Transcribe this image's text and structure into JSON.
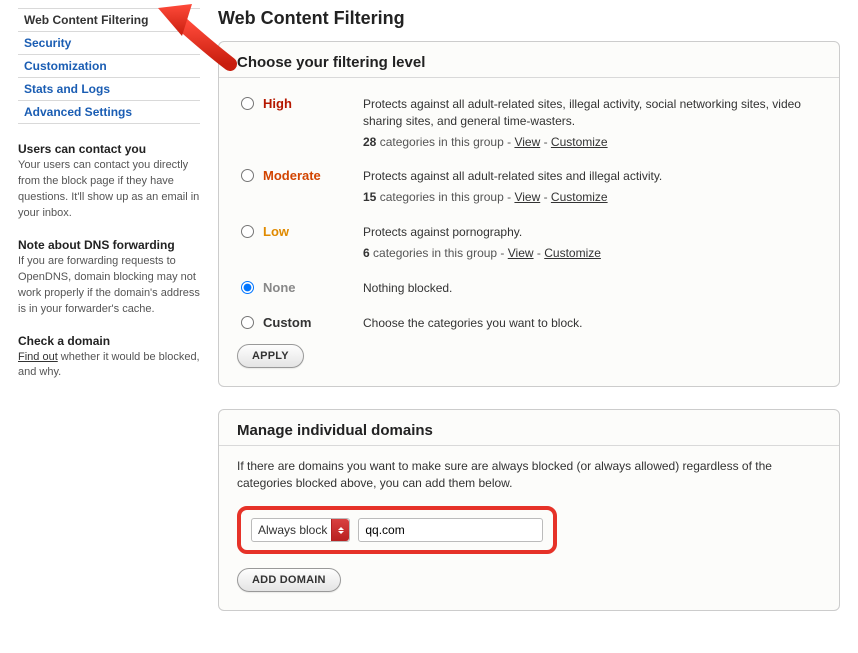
{
  "sidebar": {
    "nav": [
      {
        "label": "Web Content Filtering",
        "active": true
      },
      {
        "label": "Security"
      },
      {
        "label": "Customization"
      },
      {
        "label": "Stats and Logs"
      },
      {
        "label": "Advanced Settings"
      }
    ],
    "contact": {
      "heading": "Users can contact you",
      "body": "Your users can contact you directly from the block page if they have questions. It'll show up as an email in your inbox."
    },
    "dns": {
      "heading": "Note about DNS forwarding",
      "body": "If you are forwarding requests to OpenDNS, domain blocking may not work properly if the domain's address is in your forwarder's cache."
    },
    "check": {
      "heading": "Check a domain",
      "link": "Find out",
      "rest": " whether it would be blocked, and why."
    }
  },
  "page": {
    "title": "Web Content Filtering"
  },
  "filtering": {
    "heading": "Choose your filtering level",
    "levels": {
      "high": {
        "label": "High",
        "desc": "Protects against all adult-related sites, illegal activity, social networking sites, video sharing sites, and general time-wasters.",
        "count": "28",
        "cats_text": " categories in this group - ",
        "view": "View",
        "sep": " - ",
        "customize": "Customize"
      },
      "moderate": {
        "label": "Moderate",
        "desc": "Protects against all adult-related sites and illegal activity.",
        "count": "15",
        "cats_text": " categories in this group - ",
        "view": "View",
        "sep": " - ",
        "customize": "Customize"
      },
      "low": {
        "label": "Low",
        "desc": "Protects against pornography.",
        "count": "6",
        "cats_text": " categories in this group - ",
        "view": "View",
        "sep": " - ",
        "customize": "Customize"
      },
      "none": {
        "label": "None",
        "desc": "Nothing blocked."
      },
      "custom": {
        "label": "Custom",
        "desc": "Choose the categories you want to block."
      }
    },
    "apply": "APPLY"
  },
  "manage": {
    "heading": "Manage individual domains",
    "desc": "If there are domains you want to make sure are always blocked (or always allowed) regardless of the categories blocked above, you can add them below.",
    "mode_selected": "Always block",
    "domain_value": "qq.com",
    "add_btn": "ADD DOMAIN"
  }
}
